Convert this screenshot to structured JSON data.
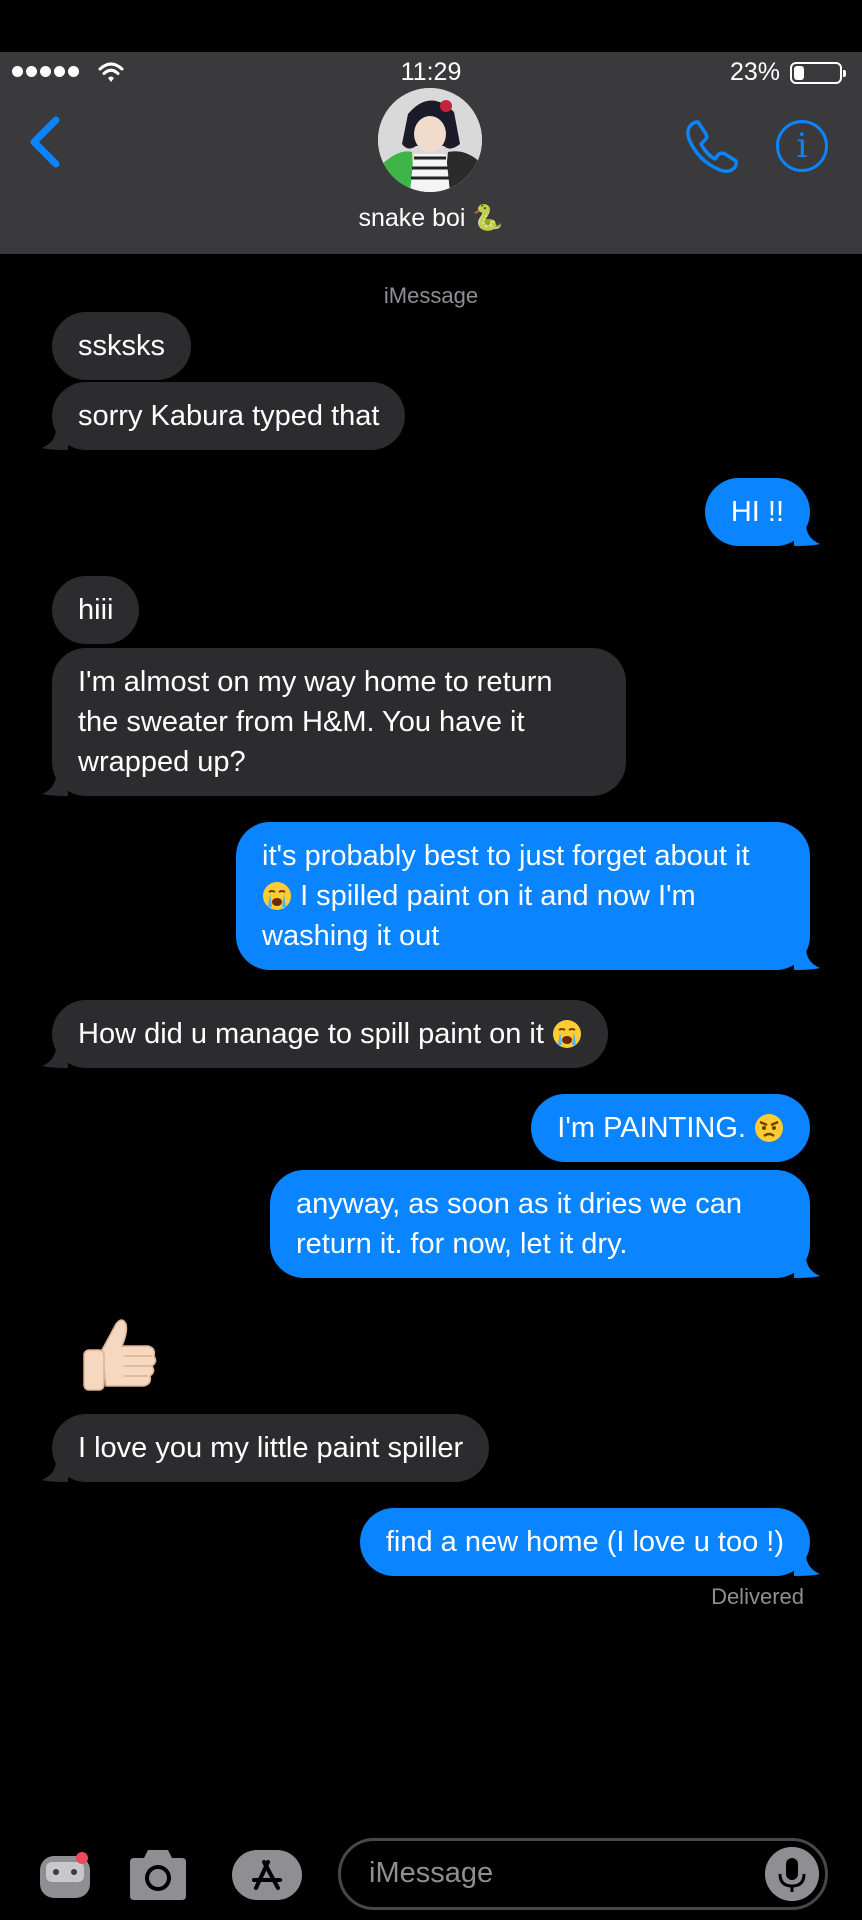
{
  "status_bar": {
    "time": "11:29",
    "battery_percent": "23%",
    "battery_level": 0.23,
    "signal_bars": 5
  },
  "header": {
    "contact_name": "snake boi 🐍",
    "back_icon": "chevron-left-icon",
    "call_icon": "phone-icon",
    "info_icon": "info-icon",
    "info_glyph": "i"
  },
  "conversation": {
    "service_label": "iMessage",
    "messages": [
      {
        "from": "them",
        "text": "ssksks"
      },
      {
        "from": "them",
        "text": "sorry Kabura typed that"
      },
      {
        "from": "me",
        "text": "HI !!"
      },
      {
        "from": "them",
        "text": "hiii"
      },
      {
        "from": "them",
        "text": "I'm almost on my way home to return the sweater from H&M. You have it wrapped up?"
      },
      {
        "from": "me",
        "text_before": "it's probably best to just forget about it",
        "emoji": "loudly-crying-face",
        "text_after": "I spilled paint on it and now I'm washing it out"
      },
      {
        "from": "them",
        "text": "How did u manage to spill paint on it",
        "emoji": "loudly-crying-face"
      },
      {
        "from": "me",
        "text": "I'm PAINTING.",
        "emoji": "angry-face"
      },
      {
        "from": "me",
        "text": "anyway, as soon as it dries we can return it. for now, let it dry."
      },
      {
        "from": "them",
        "emoji": "thumbs-up-light-skin"
      },
      {
        "from": "them",
        "text": "I love you my little paint spiller"
      },
      {
        "from": "me",
        "text": "find a new home (I love u too !)"
      }
    ],
    "delivered_label": "Delivered"
  },
  "toolbar": {
    "placeholder": "iMessage",
    "icons": [
      "memoji-sticker-icon",
      "camera-icon",
      "app-store-icon",
      "microphone-icon"
    ]
  },
  "colors": {
    "outgoing": "#0a84ff",
    "incoming": "#2c2c2e",
    "header": "#3a3a3c",
    "accent": "#0a84ff"
  }
}
